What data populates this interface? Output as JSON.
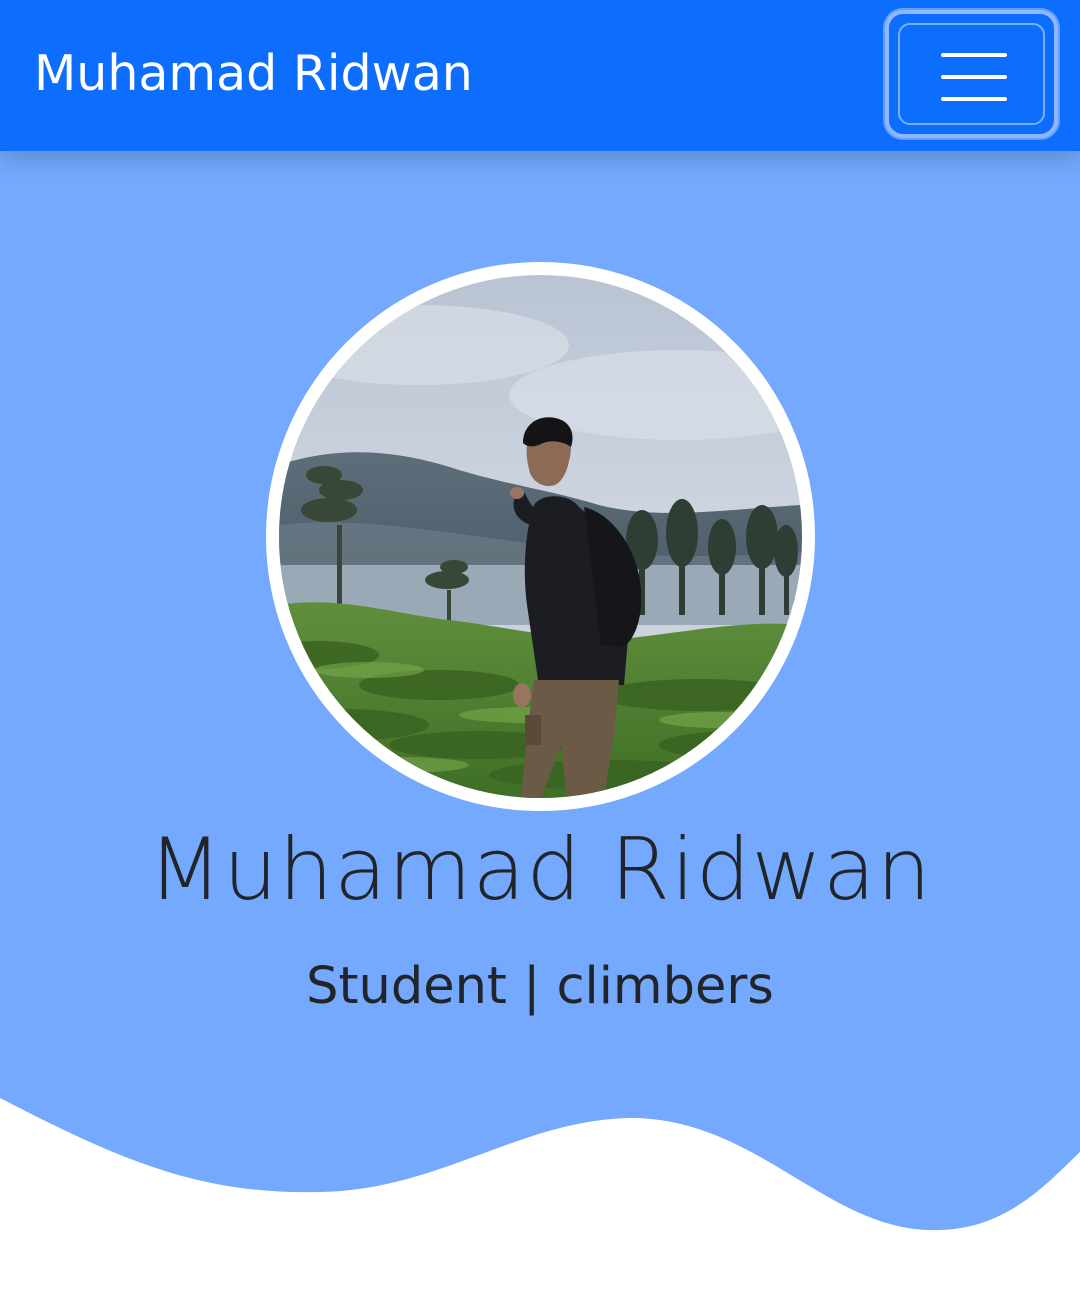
{
  "navbar": {
    "brand": "Muhamad Ridwan",
    "toggler_icon": "hamburger-menu-icon",
    "background_color": "#0d6efd"
  },
  "hero": {
    "background_color": "#74a9fd",
    "name": "Muhamad Ridwan",
    "role": "Student | climbers"
  },
  "colors": {
    "text": "#212529",
    "brand_text": "#ffffff",
    "wave": "#ffffff"
  }
}
